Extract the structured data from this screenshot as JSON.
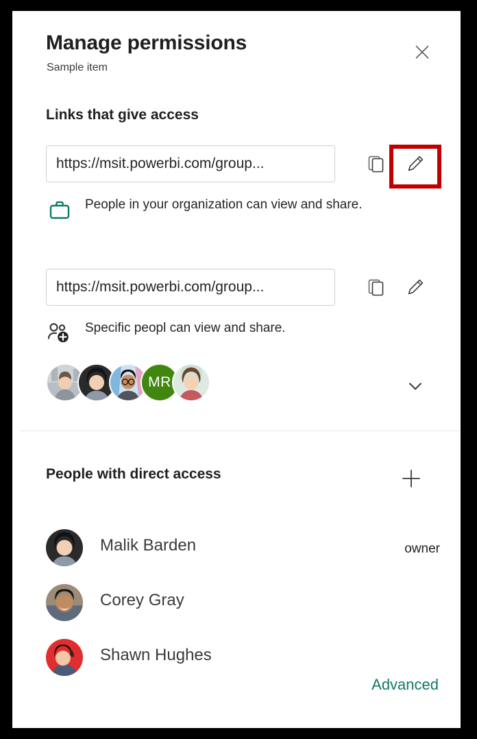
{
  "window": {
    "title": "Manage permissions",
    "subtitle": "Sample item",
    "close_label": "Close"
  },
  "links_section": {
    "heading": "Links that give access",
    "links": [
      {
        "url": "https://msit.powerbi.com/group...",
        "copy_label": "Copy link",
        "edit_label": "Edit link settings",
        "access_icon": "briefcase-icon",
        "access_text": "People in your organization can view and share.",
        "highlighted": true
      },
      {
        "url": "https://msit.powerbi.com/group...",
        "copy_label": "Copy link",
        "edit_label": "Edit link settings",
        "access_icon": "people-add-icon",
        "access_text": "Specific peopl can view and share.",
        "highlighted": false
      }
    ],
    "avatars": [
      {
        "type": "photo",
        "variant": "woman-gray",
        "initials": ""
      },
      {
        "type": "photo",
        "variant": "woman-dark-hair",
        "initials": ""
      },
      {
        "type": "photo",
        "variant": "man-glasses",
        "initials": ""
      },
      {
        "type": "initials",
        "variant": "green",
        "initials": "MR"
      },
      {
        "type": "photo",
        "variant": "woman-brown-hair",
        "initials": ""
      }
    ],
    "expand_label": "Show more"
  },
  "direct_access_section": {
    "heading": "People with direct access",
    "add_label": "Add people",
    "people": [
      {
        "name": "Malik Barden",
        "role": "owner",
        "variant": "woman-dark-hair"
      },
      {
        "name": "Corey Gray",
        "role": "",
        "variant": "man-smiling"
      },
      {
        "name": "Shawn Hughes",
        "role": "",
        "variant": "woman-red-bg"
      }
    ]
  },
  "footer": {
    "advanced_label": "Advanced"
  },
  "colors": {
    "accent_teal": "#117865",
    "highlight_red": "#c00000",
    "avatar_green": "#41870f",
    "text_primary": "#201f1e",
    "text_secondary": "#3b3a39",
    "border": "#d2d0ce",
    "divider": "#e6e6e6",
    "frame": "#000000"
  }
}
